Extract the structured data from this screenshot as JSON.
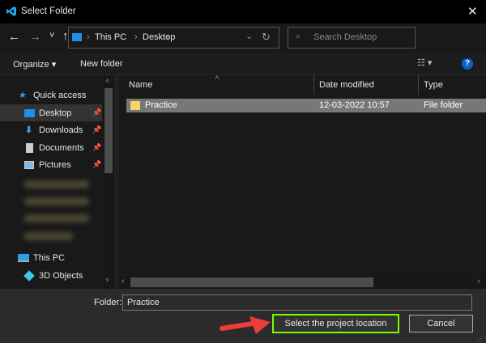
{
  "window": {
    "title": "Select Folder",
    "close": "✕"
  },
  "nav": {
    "back": "←",
    "forward": "→",
    "recent": "˅",
    "up": "↑",
    "breadcrumb": [
      "This PC",
      "Desktop"
    ],
    "search_placeholder": "Search Desktop",
    "refresh": "↻",
    "dropdown": "⌄"
  },
  "toolbar": {
    "organize": "Organize ▾",
    "new_folder": "New folder",
    "help": "?"
  },
  "sidebar": {
    "quick_access": "Quick access",
    "items": [
      {
        "label": "Desktop",
        "pinned": true
      },
      {
        "label": "Downloads",
        "pinned": true
      },
      {
        "label": "Documents",
        "pinned": true
      },
      {
        "label": "Pictures",
        "pinned": true
      }
    ],
    "this_pc": "This PC",
    "objects": "3D Objects"
  },
  "columns": {
    "name": "Name",
    "date": "Date modified",
    "type": "Type"
  },
  "files": [
    {
      "name": "Practice",
      "date": "12-03-2022 10:57",
      "type": "File folder"
    }
  ],
  "footer": {
    "folder_label": "Folder:",
    "folder_value": "Practice",
    "select": "Select the project location",
    "cancel": "Cancel"
  },
  "colors": {
    "highlight": "#7cfc00",
    "arrow": "#ee3b3b",
    "accent": "#0078d7"
  }
}
